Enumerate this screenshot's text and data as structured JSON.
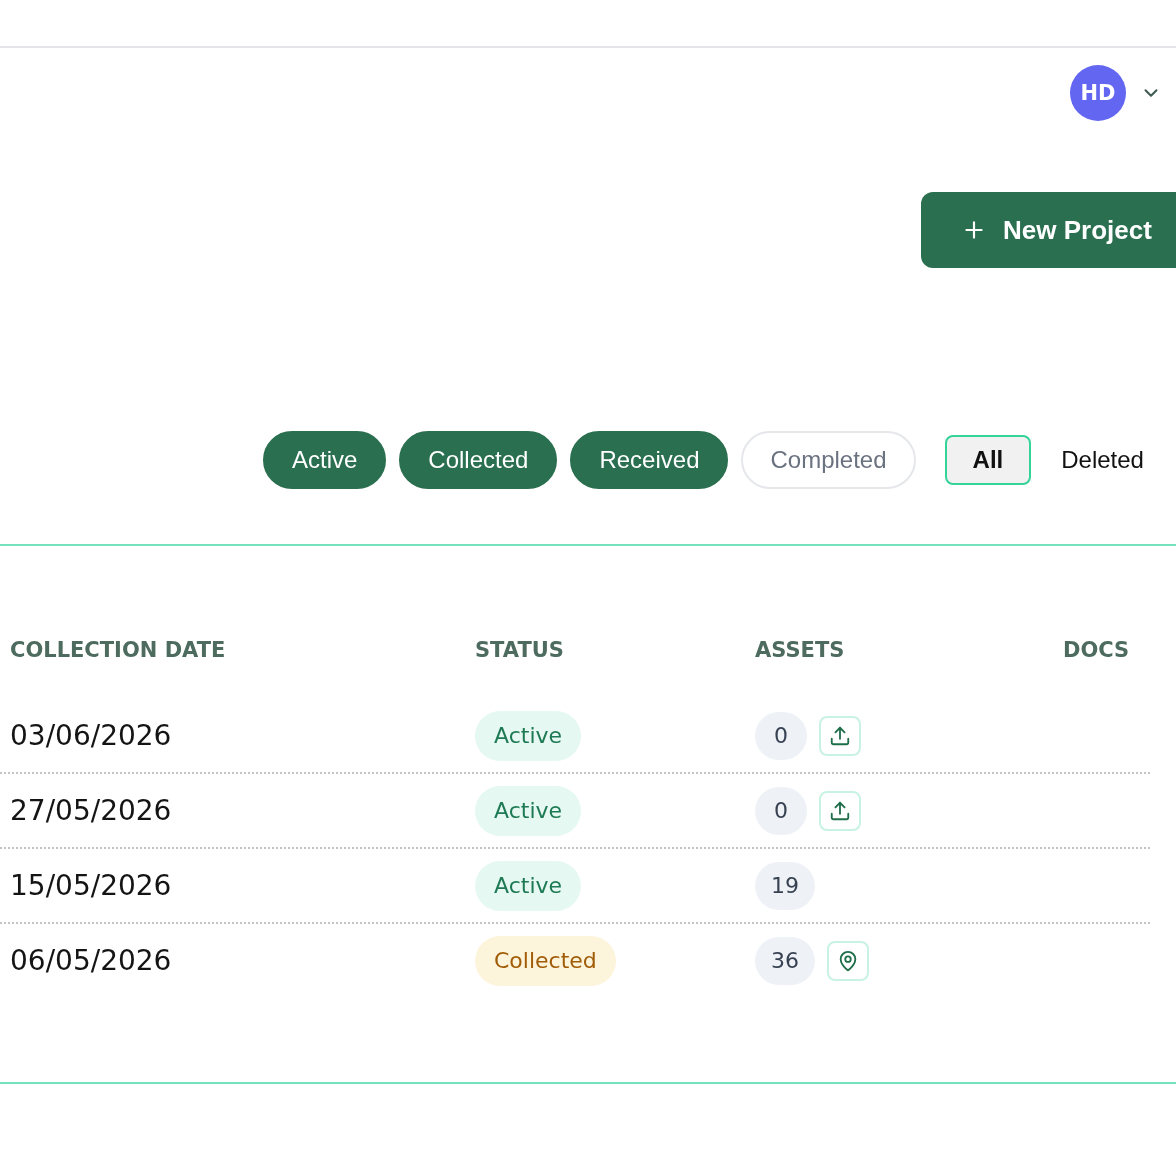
{
  "header": {
    "avatar": {
      "initials": "HD"
    }
  },
  "new_project_button": {
    "label": "New Project"
  },
  "status_filters": [
    {
      "label": "Active",
      "selected": true
    },
    {
      "label": "Collected",
      "selected": true
    },
    {
      "label": "Received",
      "selected": true
    },
    {
      "label": "Completed",
      "selected": false
    }
  ],
  "view_toggle": [
    {
      "label": "All",
      "selected": true
    },
    {
      "label": "Deleted",
      "selected": false
    }
  ],
  "table": {
    "columns": [
      "COLLECTION DATE",
      "STATUS",
      "ASSETS",
      "DOCS"
    ],
    "rows": [
      {
        "collection_date": "03/06/2026",
        "status": {
          "label": "Active",
          "kind": "active"
        },
        "assets": "0",
        "asset_button": {
          "kind": "upload"
        }
      },
      {
        "collection_date": "27/05/2026",
        "status": {
          "label": "Active",
          "kind": "active"
        },
        "assets": "0",
        "asset_button": {
          "kind": "upload"
        }
      },
      {
        "collection_date": "15/05/2026",
        "status": {
          "label": "Active",
          "kind": "active"
        },
        "assets": "19"
      },
      {
        "collection_date": "06/05/2026",
        "status": {
          "label": "Collected",
          "kind": "collected"
        },
        "assets": "36",
        "asset_button": {
          "kind": "location"
        }
      }
    ]
  }
}
